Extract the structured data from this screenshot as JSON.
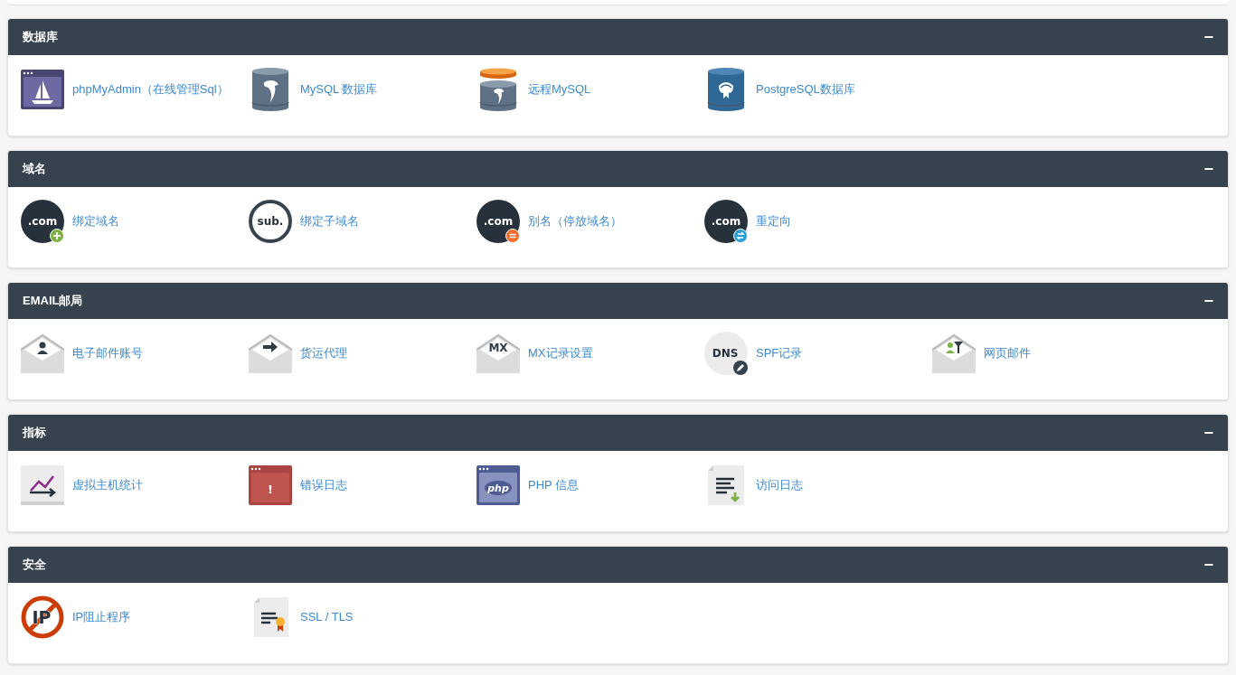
{
  "panels": [
    {
      "title": "数据库",
      "collapse_symbol": "−",
      "items": [
        {
          "label": "phpMyAdmin（在线管理Sql）",
          "kind": "sailwindow"
        },
        {
          "label": "MySQL 数据库",
          "kind": "dolphindb"
        },
        {
          "label": "远程MySQL",
          "kind": "remotedb"
        },
        {
          "label": "PostgreSQL数据库",
          "kind": "elephantdb"
        }
      ]
    },
    {
      "title": "域名",
      "collapse_symbol": "−",
      "items": [
        {
          "label": "绑定域名",
          "kind": "domainadd",
          "icon_text": ".com"
        },
        {
          "label": "绑定子域名",
          "kind": "subdomain",
          "icon_text": "sub."
        },
        {
          "label": "别名（停放域名）",
          "kind": "domainalias",
          "icon_text": ".com"
        },
        {
          "label": "重定向",
          "kind": "domainredirect",
          "icon_text": ".com"
        }
      ]
    },
    {
      "title": "EMAIL邮局",
      "collapse_symbol": "−",
      "items": [
        {
          "label": "电子邮件账号",
          "kind": "mailperson"
        },
        {
          "label": "货运代理",
          "kind": "mailforward"
        },
        {
          "label": "MX记录设置",
          "kind": "mailtext",
          "icon_text": "MX"
        },
        {
          "label": "SPF记录",
          "kind": "dns",
          "icon_text": "DNS"
        },
        {
          "label": "网页邮件",
          "kind": "mailfilter"
        }
      ]
    },
    {
      "title": "指标",
      "collapse_symbol": "−",
      "items": [
        {
          "label": "虚拟主机统计",
          "kind": "chart"
        },
        {
          "label": "错误日志",
          "kind": "errorwindow",
          "icon_text": "!"
        },
        {
          "label": "PHP 信息",
          "kind": "phpwindow",
          "icon_text": "php"
        },
        {
          "label": "访问日志",
          "kind": "logdownload"
        }
      ]
    },
    {
      "title": "安全",
      "collapse_symbol": "−",
      "items": [
        {
          "label": "IP阻止程序",
          "kind": "ipblock",
          "icon_text": "IP"
        },
        {
          "label": "SSL / TLS",
          "kind": "certificate"
        }
      ]
    }
  ]
}
